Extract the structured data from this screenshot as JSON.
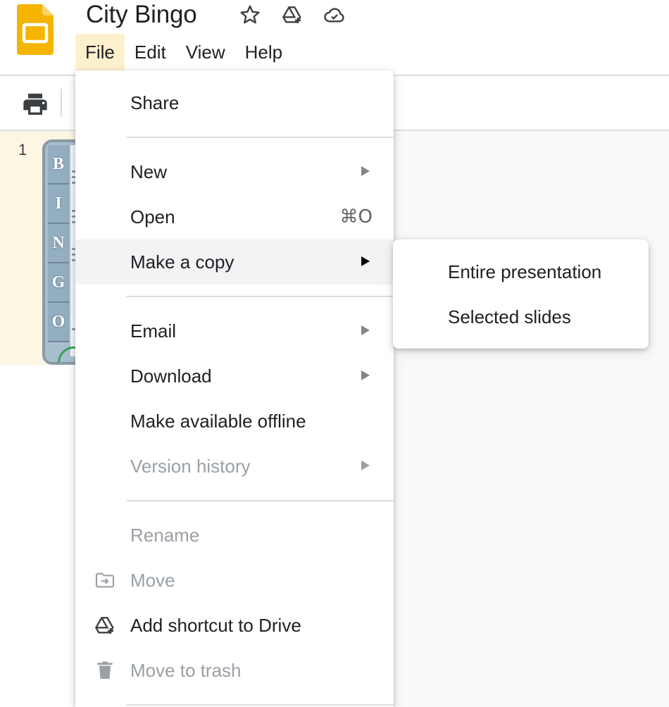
{
  "app": {
    "logo_icon": "google-slides-logo",
    "brand_color": "#f4b400",
    "document_title": "City Bingo",
    "title_icons": [
      "star-icon",
      "move-to-drive-icon",
      "cloud-saved-icon"
    ]
  },
  "menubar": {
    "items": [
      {
        "label": "File",
        "active": true
      },
      {
        "label": "Edit"
      },
      {
        "label": "View"
      },
      {
        "label": "Help"
      }
    ]
  },
  "toolbar": {
    "icons": [
      "print-icon"
    ]
  },
  "filmstrip": {
    "slides": [
      {
        "number": "1",
        "bingo_letters": [
          "B",
          "I",
          "N",
          "G",
          "O"
        ],
        "selected": true
      }
    ],
    "selected_color": "#fdf6e3"
  },
  "file_menu": {
    "share": "Share",
    "new": "New",
    "open": "Open",
    "open_shortcut": "⌘O",
    "make_copy": "Make a copy",
    "email": "Email",
    "download": "Download",
    "make_offline": "Make available offline",
    "version_history": "Version history",
    "rename": "Rename",
    "move": "Move",
    "add_shortcut": "Add shortcut to Drive",
    "move_to_trash": "Move to trash",
    "highlighted_item": "Make a copy",
    "disabled_items": [
      "Version history",
      "Rename",
      "Move",
      "Move to trash"
    ],
    "highlight_color": "#f1f3f4",
    "active_menu_color": "#fdf0cd"
  },
  "copy_submenu": {
    "entire_presentation": "Entire presentation",
    "selected_slides": "Selected slides"
  }
}
